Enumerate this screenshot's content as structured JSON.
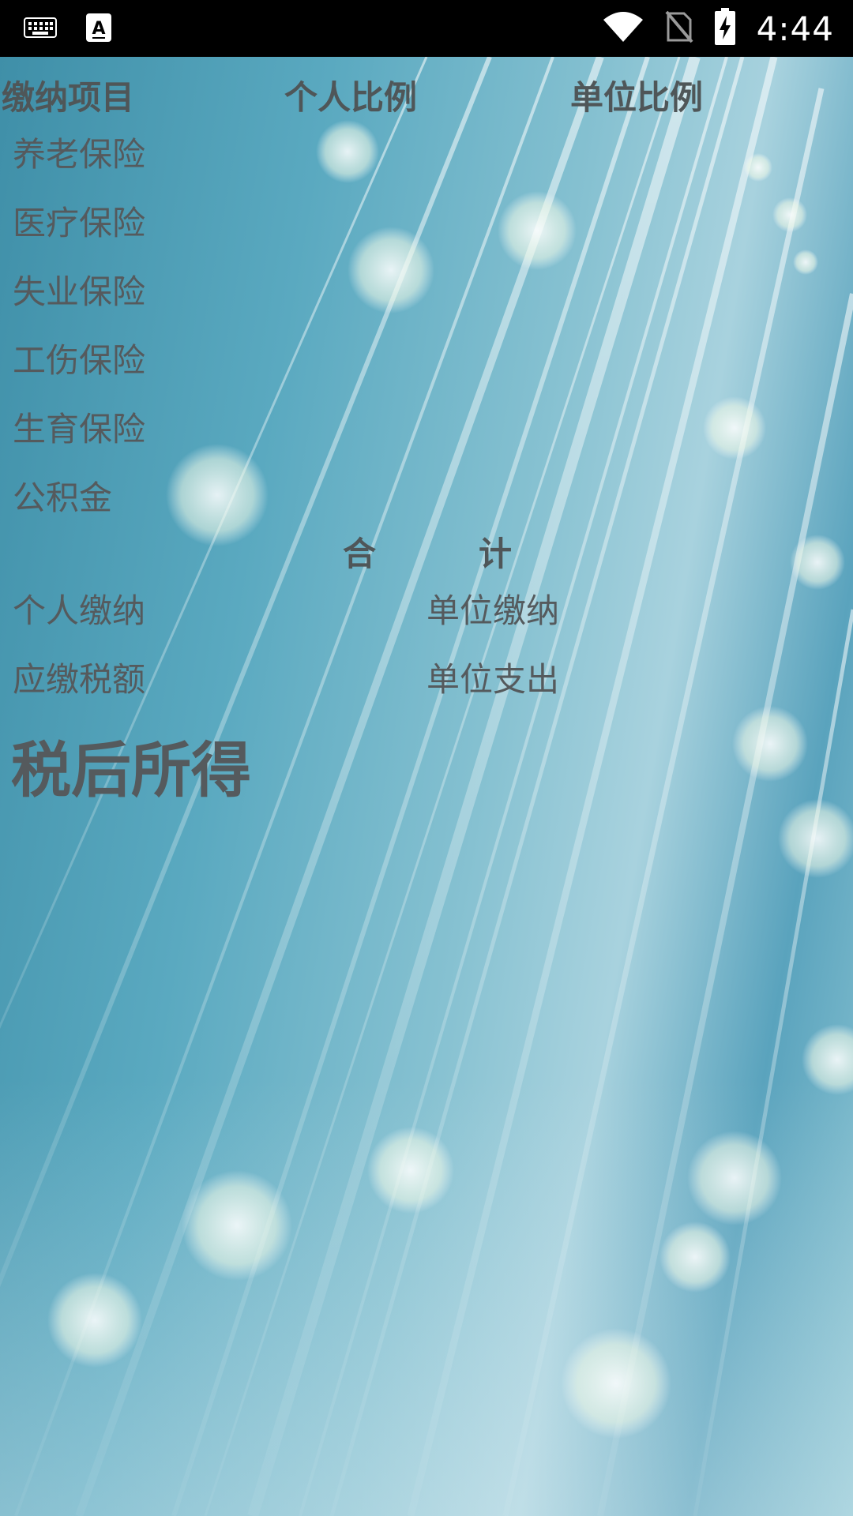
{
  "status_bar": {
    "time": "4:44"
  },
  "table": {
    "headers": [
      "缴纳项目",
      "个人比例",
      "单位比例"
    ],
    "items": [
      "养老保险",
      "医疗保险",
      "失业保险",
      "工伤保险",
      "生育保险",
      "公积金"
    ]
  },
  "total": {
    "char1": "合",
    "char2": "计"
  },
  "summary": {
    "personal_payment": "个人缴纳",
    "company_payment": "单位缴纳",
    "tax_due": "应缴税额",
    "company_expense": "单位支出"
  },
  "after_tax": "税后所得",
  "colors": {
    "status_bar": "#000000",
    "text": "#555a5d",
    "background_accent": "#5aa9c0"
  }
}
